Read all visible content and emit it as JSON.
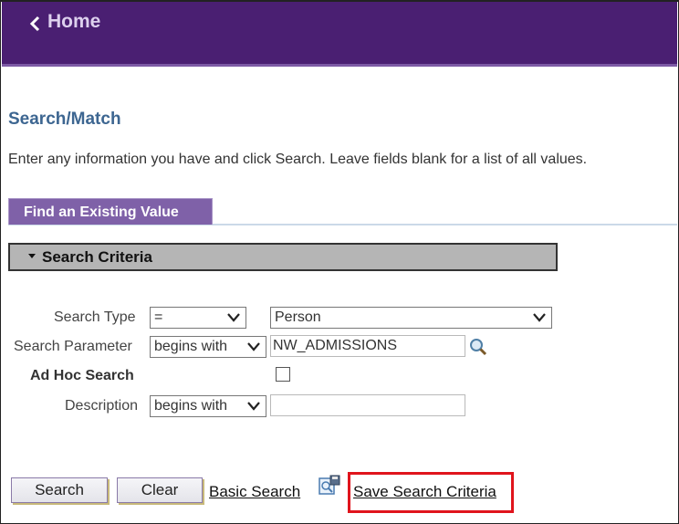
{
  "header": {
    "back_label": "Home",
    "bg_color": "#4a1f72"
  },
  "page": {
    "title": "Search/Match",
    "instructions": "Enter any information you have and click Search. Leave fields blank for a list of all values."
  },
  "tab": {
    "label": "Find an Existing Value"
  },
  "section": {
    "title": "Search Criteria"
  },
  "form": {
    "search_type": {
      "label": "Search Type",
      "operator": "=",
      "value": "Person"
    },
    "search_parameter": {
      "label": "Search Parameter",
      "operator": "begins with",
      "value": "NW_ADMISSIONS"
    },
    "ad_hoc": {
      "label": "Ad Hoc Search"
    },
    "description": {
      "label": "Description",
      "operator": "begins with",
      "value": ""
    }
  },
  "actions": {
    "search_label": "Search",
    "clear_label": "Clear",
    "basic_search_label": "Basic Search",
    "save_criteria_label": "Save Search Criteria"
  },
  "icons": {
    "back": "chevron-left-icon",
    "lookup": "magnifier-icon",
    "save": "save-search-icon"
  },
  "colors": {
    "highlight": "#e0141c",
    "title": "#3d6691",
    "tab": "#7f61a8"
  }
}
